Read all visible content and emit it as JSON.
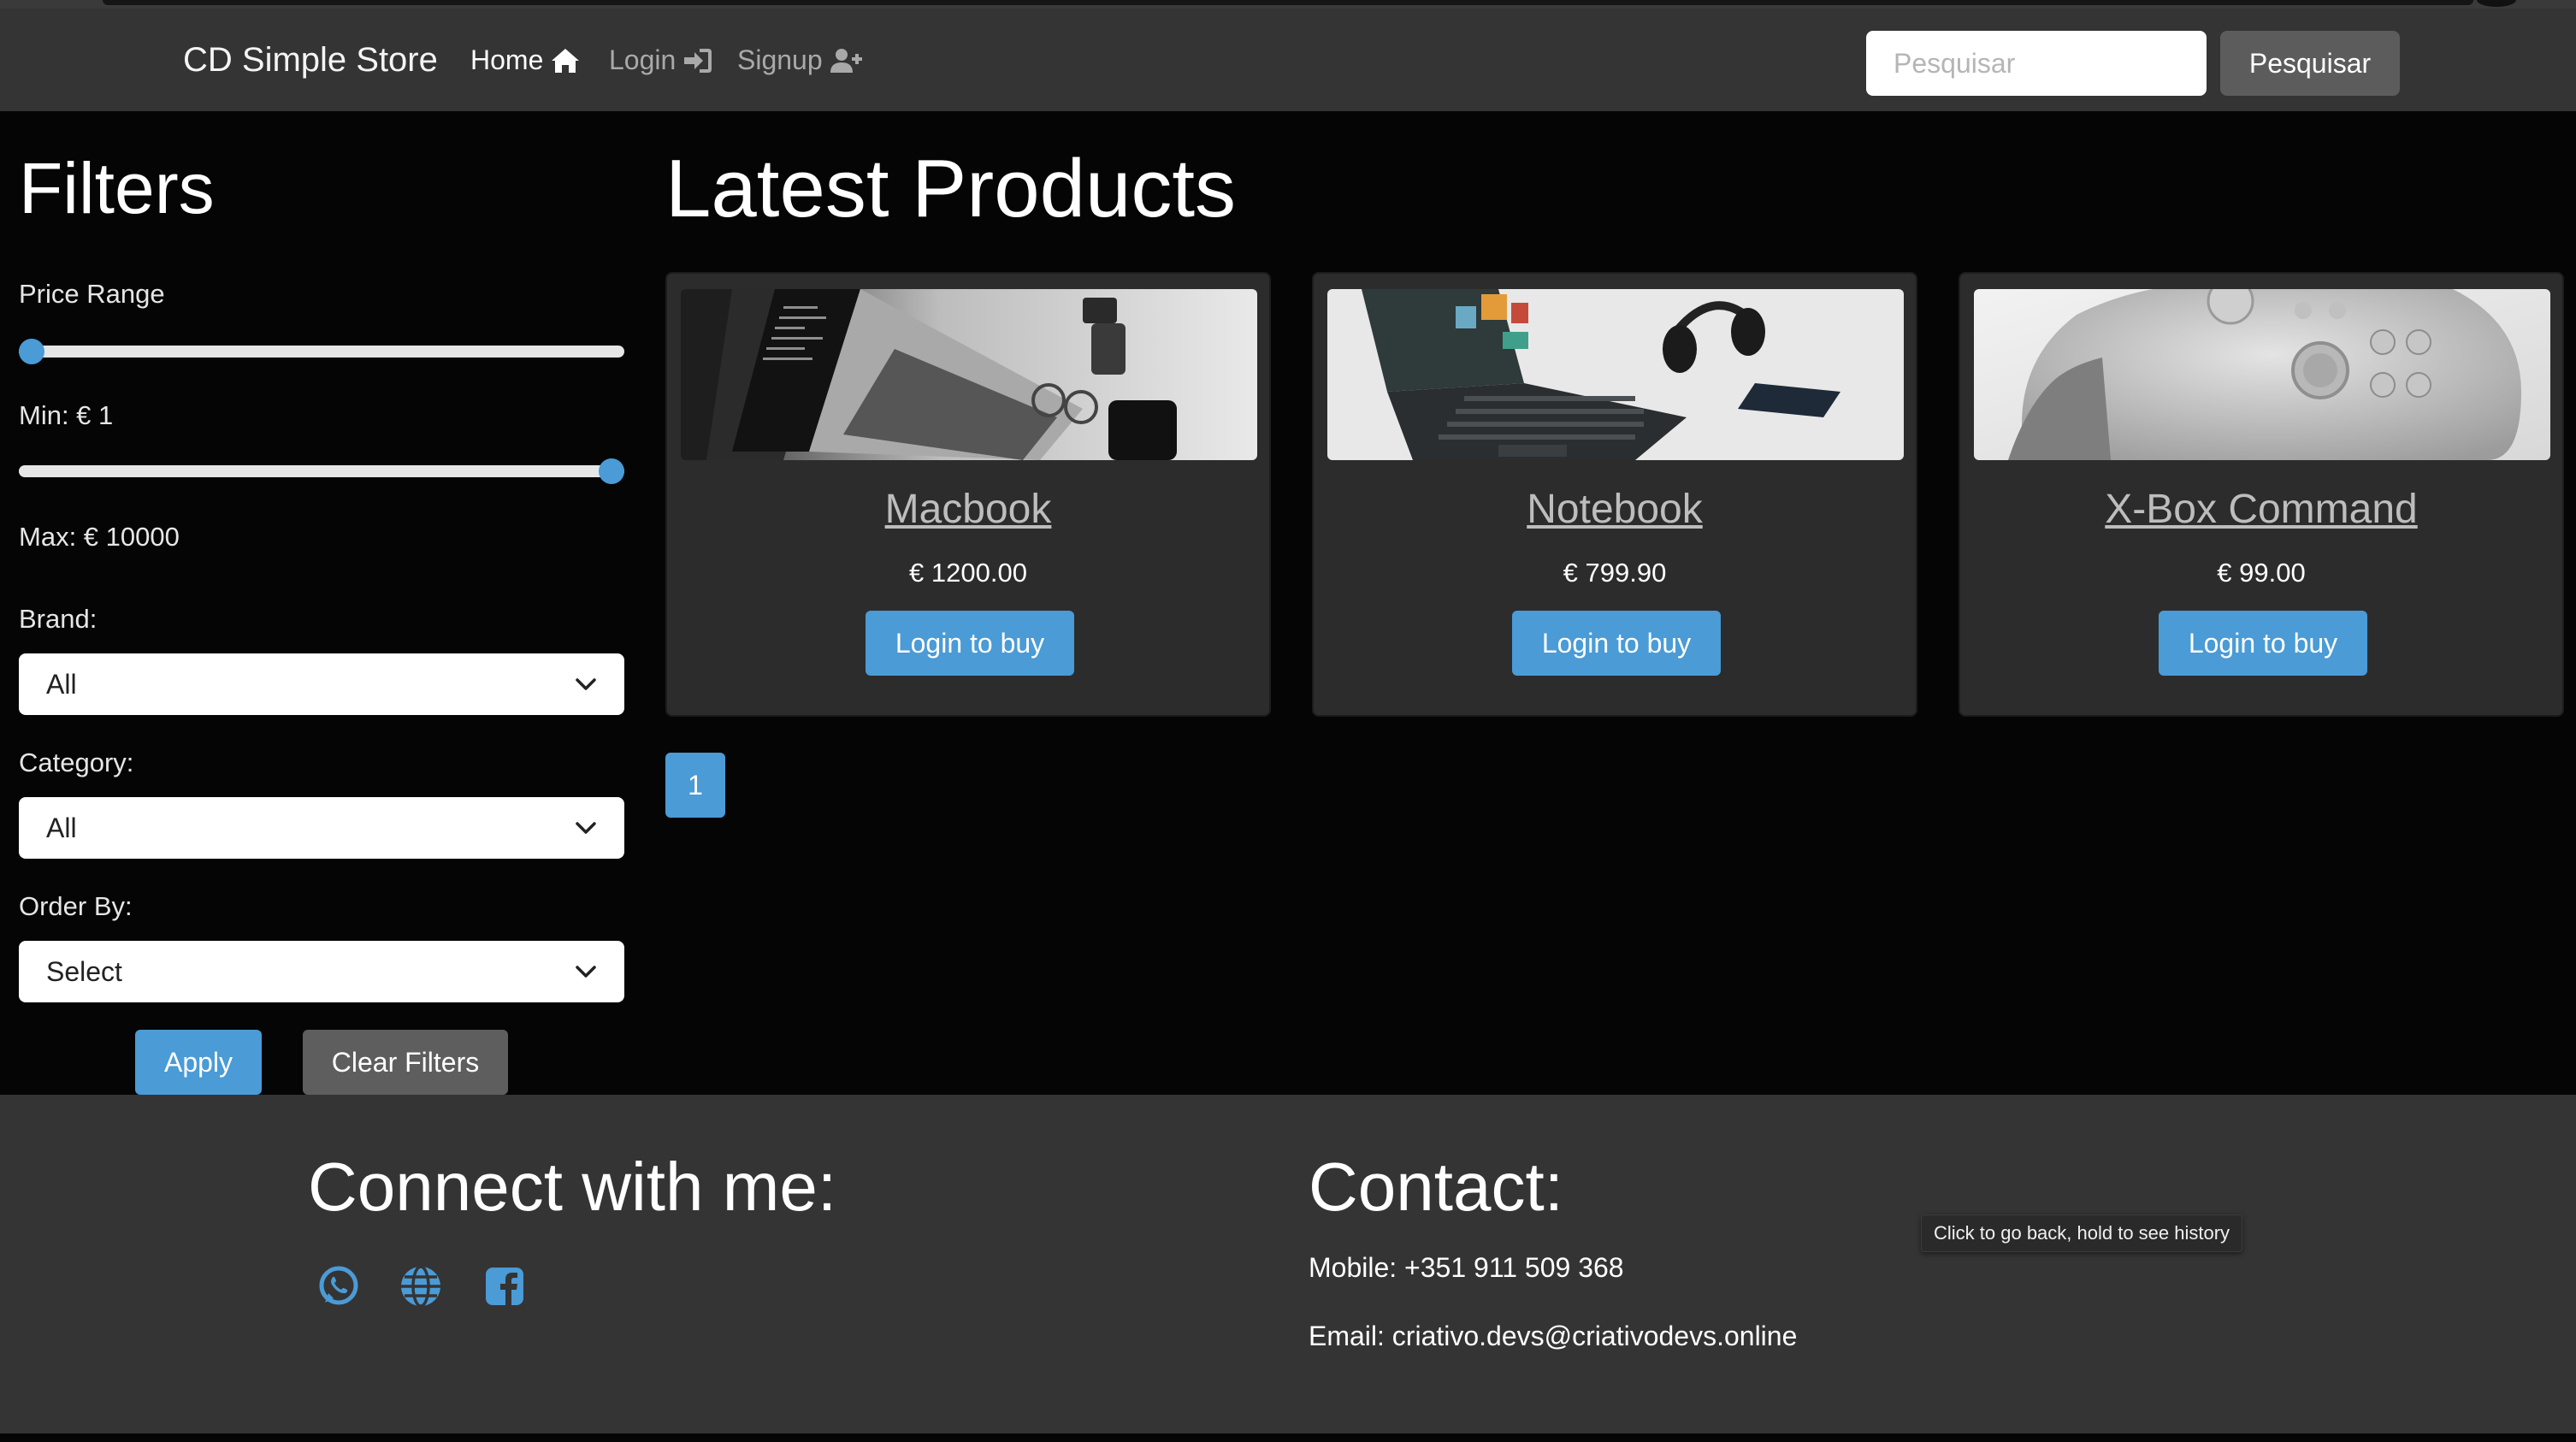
{
  "navbar": {
    "brand": "CD Simple Store",
    "links": [
      {
        "label": "Home",
        "icon": "home-icon",
        "active": true
      },
      {
        "label": "Login",
        "icon": "login-arrow-icon",
        "active": false
      },
      {
        "label": "Signup",
        "icon": "user-plus-icon",
        "active": false
      }
    ],
    "search_placeholder": "Pesquisar",
    "search_button": "Pesquisar"
  },
  "filters": {
    "title": "Filters",
    "price_range_label": "Price Range",
    "min_label": "Min: € 1",
    "max_label": "Max: € 10000",
    "min_value": 1,
    "max_value": 10000,
    "brand_label": "Brand:",
    "brand_selected": "All",
    "category_label": "Category:",
    "category_selected": "All",
    "order_label": "Order By:",
    "order_selected": "Select",
    "apply_button": "Apply",
    "clear_button": "Clear Filters"
  },
  "main": {
    "title": "Latest Products",
    "products": [
      {
        "name": "Macbook",
        "price": "€ 1200.00",
        "button": "Login to buy",
        "image": "laptop-dark-photo"
      },
      {
        "name": "Notebook",
        "price": "€ 799.90",
        "button": "Login to buy",
        "image": "laptop-headphones-photo"
      },
      {
        "name": "X-Box Command",
        "price": "€ 99.00",
        "button": "Login to buy",
        "image": "controller-silver-photo"
      }
    ],
    "pagination": [
      "1"
    ]
  },
  "footer": {
    "connect_title": "Connect with me:",
    "social_icons": [
      "whatsapp-icon",
      "globe-icon",
      "facebook-icon"
    ],
    "contact_title": "Contact:",
    "mobile": "Mobile: +351 911 509 368",
    "email": "Email: criativo.devs@criativodevs.online"
  },
  "tooltip": "Click to go back, hold to see history",
  "colors": {
    "accent": "#4a9bd6",
    "navbar_bg": "#343434",
    "page_bg": "#050505",
    "card_bg": "#2c2c2c"
  }
}
